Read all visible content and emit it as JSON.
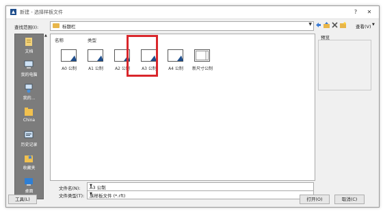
{
  "window": {
    "title": "新建 - 选择样板文件",
    "help": "?",
    "close": "✕"
  },
  "toolbar": {
    "look_in_label": "查找范围(I):",
    "look_in_value": "标题栏",
    "views_label": "查看(V)"
  },
  "places": [
    {
      "label": "文档"
    },
    {
      "label": "我的电脑"
    },
    {
      "label": "我的..."
    },
    {
      "label": "China"
    },
    {
      "label": "历史记录"
    },
    {
      "label": "收藏夹"
    },
    {
      "label": "桌面"
    }
  ],
  "filelist": {
    "col_name": "名称",
    "col_type": "类型",
    "files": [
      {
        "label": "A0 公制"
      },
      {
        "label": "A1 公制"
      },
      {
        "label": "A2 公制"
      },
      {
        "label": "A3 公制"
      },
      {
        "label": "A4 公制"
      },
      {
        "label": "新尺寸公制"
      }
    ],
    "selected_index": 3
  },
  "preview": {
    "label": "预览"
  },
  "bottom": {
    "filename_label": "文件名(N):",
    "filename_value": "A3 公制",
    "filetype_label": "文件类型(T):",
    "filetype_value": "族样板文件 (*.rft)",
    "tools_label": "工具(L)",
    "open_label": "打开(O)",
    "cancel_label": "取消(C)"
  },
  "colors": {
    "accent_highlight": "#d9262b",
    "places_bg": "#7c7c7c"
  }
}
